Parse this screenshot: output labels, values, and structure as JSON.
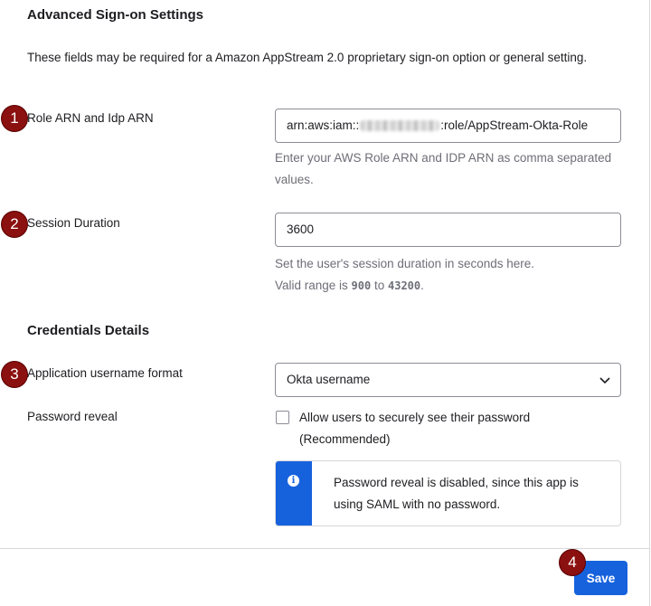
{
  "sections": {
    "advanced_title": "Advanced Sign-on Settings",
    "advanced_desc": "These fields may be required for a Amazon AppStream 2.0 proprietary sign-on option or general setting.",
    "credentials_title": "Credentials Details"
  },
  "fields": {
    "role_arn": {
      "label": "Role ARN and Idp ARN",
      "value_prefix": "arn:aws:iam::",
      "value_suffix": ":role/AppStream-Okta-Role",
      "hint": "Enter your AWS Role ARN and IDP ARN as comma separated values."
    },
    "session_duration": {
      "label": "Session Duration",
      "value": "3600",
      "hint_line1": "Set the user's session duration in seconds here.",
      "hint_prefix": "Valid range is ",
      "hint_min": "900",
      "hint_mid": " to ",
      "hint_max": "43200",
      "hint_end": "."
    },
    "username_format": {
      "label": "Application username format",
      "value": "Okta username"
    },
    "password_reveal": {
      "label": "Password reveal",
      "checkbox_label": "Allow users to securely see their password (Recommended)",
      "checked": false,
      "callout": "Password reveal is disabled, since this app is using SAML with no password."
    }
  },
  "actions": {
    "save_label": "Save"
  },
  "annotations": {
    "m1": "1",
    "m2": "2",
    "m3": "3",
    "m4": "4",
    "color": "#8b1010"
  },
  "colors": {
    "primary": "#1662dd",
    "text": "#1d1d21",
    "muted": "#6e6e78",
    "border": "#8c8c96"
  }
}
